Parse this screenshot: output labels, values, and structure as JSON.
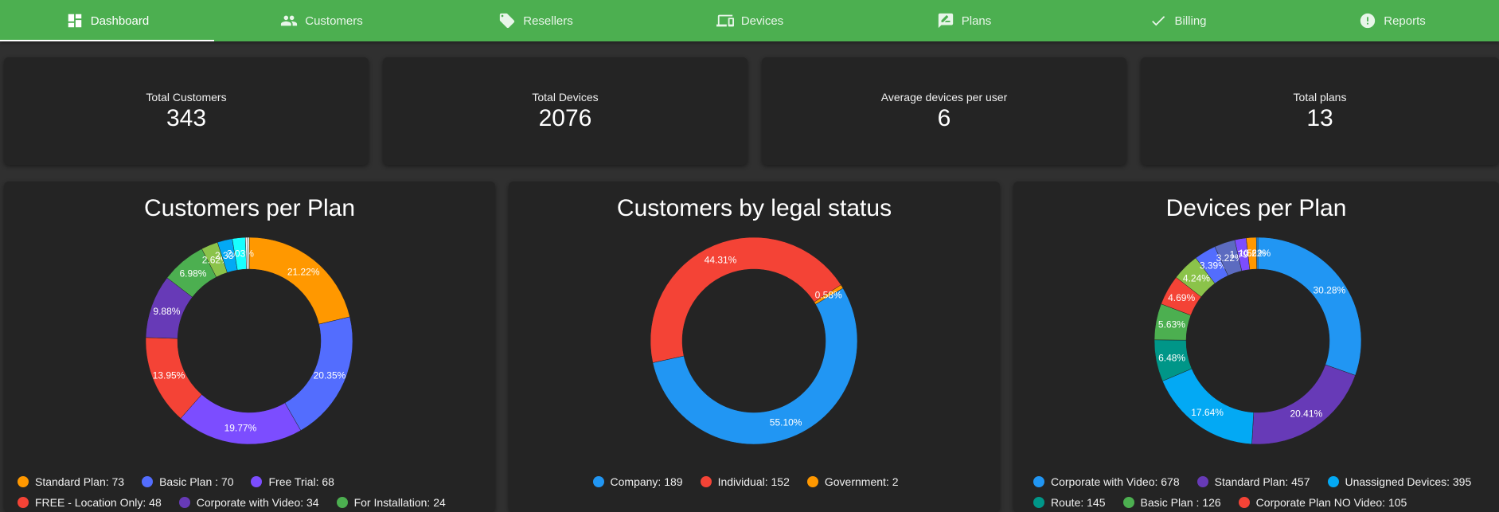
{
  "nav": {
    "tabs": [
      {
        "label": "Dashboard",
        "icon": "dashboard-icon",
        "active": true
      },
      {
        "label": "Customers",
        "icon": "people-icon",
        "active": false
      },
      {
        "label": "Resellers",
        "icon": "tag-icon",
        "active": false
      },
      {
        "label": "Devices",
        "icon": "devices-icon",
        "active": false
      },
      {
        "label": "Plans",
        "icon": "plan-icon",
        "active": false
      },
      {
        "label": "Billing",
        "icon": "check-icon",
        "active": false
      },
      {
        "label": "Reports",
        "icon": "alert-circle-icon",
        "active": false
      }
    ]
  },
  "stats": [
    {
      "label": "Total Customers",
      "value": "343"
    },
    {
      "label": "Total Devices",
      "value": "2076"
    },
    {
      "label": "Average devices per user",
      "value": "6"
    },
    {
      "label": "Total plans",
      "value": "13"
    }
  ],
  "chart_data": [
    {
      "type": "pie",
      "title": "Customers per Plan",
      "slices": [
        {
          "label": "Standard Plan",
          "value": 73,
          "percent": "21.22%",
          "color": "#ff9800"
        },
        {
          "label": "Basic Plan ",
          "value": 70,
          "percent": "20.35%",
          "color": "#536dfe"
        },
        {
          "label": "Free Trial",
          "value": 68,
          "percent": "19.77%",
          "color": "#7c4dff"
        },
        {
          "label": "FREE - Location Only",
          "value": 48,
          "percent": "13.95%",
          "color": "#f44336"
        },
        {
          "label": "Corporate with Video",
          "value": 34,
          "percent": "9.88%",
          "color": "#673ab7"
        },
        {
          "label": "For Installation",
          "value": 24,
          "percent": "6.98%",
          "color": "#4caf50"
        },
        {
          "label": "",
          "value": 9,
          "percent": "2.62%",
          "color": "#8bc34a"
        },
        {
          "label": "",
          "value": 8,
          "percent": "2.33%",
          "color": "#03a9f4"
        },
        {
          "label": "",
          "value": 7,
          "percent": "2.03%",
          "color": "#18ffff"
        },
        {
          "label": "",
          "value": 1,
          "percent": "",
          "color": "#ffffff"
        },
        {
          "label": "",
          "value": 1,
          "percent": "",
          "color": "#ffffff"
        }
      ],
      "legend": [
        [
          "Standard Plan: 73",
          "Basic Plan : 70",
          "Free Trial: 68"
        ],
        [
          "FREE - Location Only: 48",
          "Corporate with Video: 34",
          "For Installation: 24"
        ]
      ]
    },
    {
      "type": "pie",
      "title": "Customers by legal status",
      "slices": [
        {
          "label": "Company",
          "value": 189,
          "percent": "55.10%",
          "color": "#2196f3"
        },
        {
          "label": "Individual",
          "value": 152,
          "percent": "44.31%",
          "color": "#f44336"
        },
        {
          "label": "Government",
          "value": 2,
          "percent": "0.58%",
          "color": "#ff9800"
        }
      ],
      "legend": [
        [
          "Company: 189",
          "Individual: 152",
          "Government: 2"
        ]
      ]
    },
    {
      "type": "pie",
      "title": "Devices per Plan",
      "slices": [
        {
          "label": "Corporate with Video",
          "value": 678,
          "percent": "30.28%",
          "color": "#2196f3"
        },
        {
          "label": "Standard Plan",
          "value": 457,
          "percent": "20.41%",
          "color": "#673ab7"
        },
        {
          "label": "Unassigned Devices",
          "value": 395,
          "percent": "17.64%",
          "color": "#03a9f4"
        },
        {
          "label": "Route",
          "value": 145,
          "percent": "6.48%",
          "color": "#009688"
        },
        {
          "label": "Basic Plan ",
          "value": 126,
          "percent": "5.63%",
          "color": "#4caf50"
        },
        {
          "label": "Corporate Plan NO Video",
          "value": 105,
          "percent": "4.69%",
          "color": "#f44336"
        },
        {
          "label": "",
          "value": 95,
          "percent": "4.24%",
          "color": "#8bc34a"
        },
        {
          "label": "",
          "value": 76,
          "percent": "3.39%",
          "color": "#536dfe"
        },
        {
          "label": "",
          "value": 72,
          "percent": "3.22%",
          "color": "#5c6bc0"
        },
        {
          "label": "",
          "value": 40,
          "percent": "1.79%",
          "color": "#7c4dff"
        },
        {
          "label": "",
          "value": 35,
          "percent": "1.56%",
          "color": "#ff9800"
        },
        {
          "label": "",
          "value": 5,
          "percent": "0.22%",
          "color": "#2196f3"
        }
      ],
      "legend": [
        [
          "Corporate with Video: 678",
          "Standard Plan: 457",
          "Unassigned Devices: 395"
        ],
        [
          "Route: 145",
          "Basic Plan : 126",
          "Corporate Plan NO Video: 105"
        ]
      ]
    }
  ]
}
